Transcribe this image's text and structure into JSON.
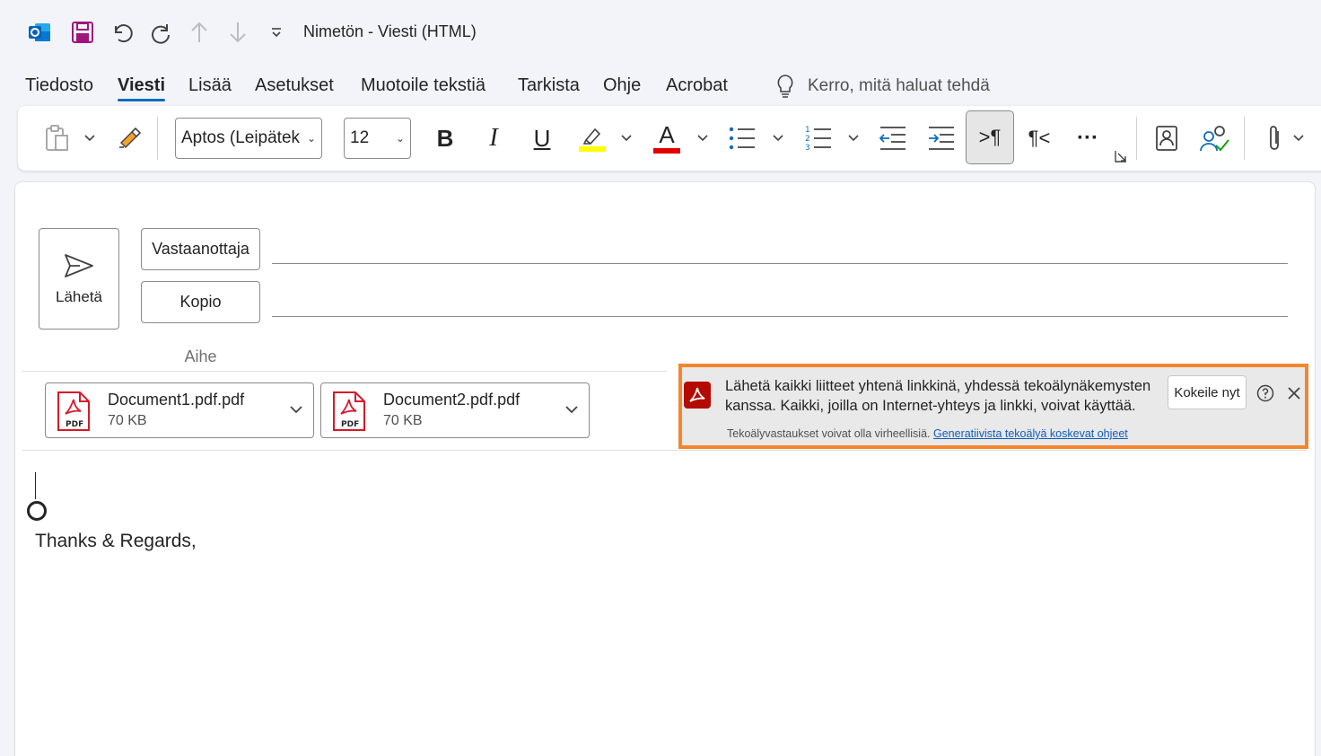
{
  "window": {
    "title": "Nimetön  -  Viesti (HTML)"
  },
  "tabs": [
    {
      "label": "Tiedosto"
    },
    {
      "label": "Viesti"
    },
    {
      "label": "Lisää"
    },
    {
      "label": "Asetukset"
    },
    {
      "label": "Muotoile tekstiä"
    },
    {
      "label": "Tarkista"
    },
    {
      "label": "Ohje"
    },
    {
      "label": "Acrobat"
    }
  ],
  "active_tab": "Viesti",
  "tell_me": {
    "placeholder": "Kerro, mitä haluat tehdä"
  },
  "ribbon": {
    "font_name": "Aptos (Leipätek",
    "font_size": "12",
    "bold_label": "B",
    "italic_label": "I",
    "underline_label": "U",
    "font_color_label": "A",
    "highlight_color": "#ffff00",
    "font_color": "#e00000",
    "ltr_label": ">¶",
    "rtl_label": "¶<",
    "more_label": "···"
  },
  "compose": {
    "send_label": "Lähetä",
    "to_label": "Vastaanottaja",
    "cc_label": "Kopio",
    "subject_label": "Aihe"
  },
  "attachments": [
    {
      "name": "Document1.pdf.pdf",
      "size": "70 KB"
    },
    {
      "name": "Document2.pdf.pdf",
      "size": "70 KB"
    }
  ],
  "banner": {
    "message": "Lähetä kaikki liitteet yhtenä linkkinä, yhdessä tekoälynäkemysten kanssa. Kaikki, joilla on Internet-yhteys ja linkki, voivat käyttää.",
    "try_label": "Kokeile nyt",
    "disclaimer": "Tekoälyvastaukset voivat olla virheellisiä.",
    "link_text": "Generatiivista tekoälyä koskevat ohjeet",
    "border_color": "#f3862c"
  },
  "body": {
    "signature": "Thanks & Regards,"
  },
  "icons": {
    "pdf_label": "PDF"
  }
}
